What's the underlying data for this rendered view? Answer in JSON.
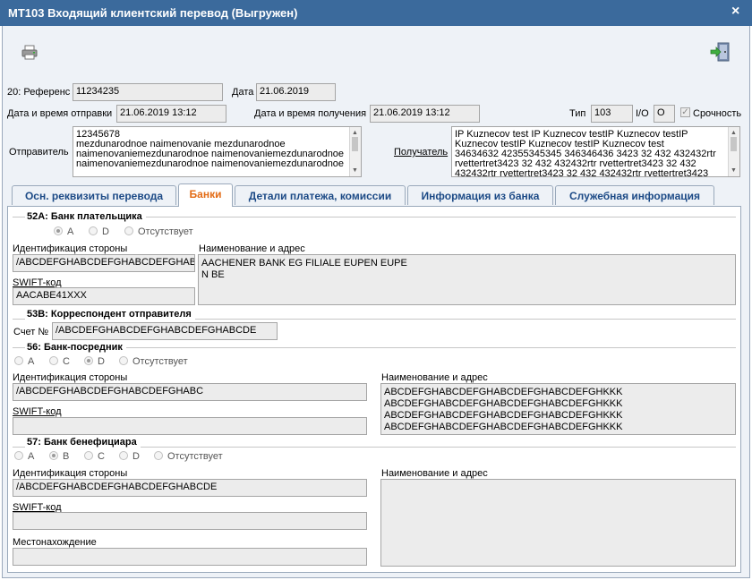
{
  "window": {
    "title": "MT103 Входящий клиентский перевод (Выгружен)",
    "close_glyph": "×"
  },
  "toolbar": {
    "print_icon": "printer-icon",
    "exit_icon": "exit-door-icon"
  },
  "header": {
    "reference_label": "20: Референс",
    "reference_value": "11234235",
    "date_label": "Дата",
    "date_value": "21.06.2019",
    "sent_label": "Дата и время отправки",
    "sent_value": "21.06.2019 13:12",
    "received_label": "Дата и время получения",
    "received_value": "21.06.2019 13:12",
    "type_label": "Тип",
    "type_value": "103",
    "io_label": "I/O",
    "io_value": "O",
    "urgency_label": "Срочность",
    "urgency_checked": true,
    "sender_label": "Отправитель",
    "sender_text": "12345678\nmezdunarodnoe naimenovanie mezdunarodnoe\nnaimenovaniemezdunarodnoe naimenovaniemezdunarodnoe\nnaimenovaniemezdunarodnoe naimenovaniemezdunarodnoe",
    "receiver_label": "Получатель",
    "receiver_text": "IP Kuznecov test IP Kuznecov testIP Kuznecov testIP\nKuznecov testIP Kuznecov testIP Kuznecov test\n34634632 42355345345 346346436 3423 32 432 432432rtr\nrvettertret3423 32 432 432432rtr rvettertret3423 32 432\n432432rtr rvettertret3423 32 432 432432rtr rvettertret3423"
  },
  "tabs": [
    {
      "label": "Осн. реквизиты перевода",
      "active": false
    },
    {
      "label": "Банки",
      "active": true
    },
    {
      "label": "Детали платежа, комиссии",
      "active": false
    },
    {
      "label": "Информация из банка",
      "active": false
    },
    {
      "label": "Служебная информация",
      "active": false
    }
  ],
  "s52a": {
    "title": "52А: Банк плательщика",
    "options": [
      "A",
      "D",
      "Отсутствует"
    ],
    "selected": "A",
    "party_label": "Идентификация стороны",
    "party_value": "/ABCDEFGHABCDEFGHABCDEFGHABCD",
    "swift_label": "SWIFT-код",
    "swift_value": "AACABE41XXX",
    "name_label": "Наименование и адрес",
    "name_value": "AACHENER BANK EG FILIALE EUPEN EUPE\nN BE"
  },
  "s53b": {
    "title": "53В: Корреспондент отправителя",
    "account_label": "Счет №",
    "account_value": "/ABCDEFGHABCDEFGHABCDEFGHABCDE"
  },
  "s56": {
    "title": "56: Банк-посредник",
    "options": [
      "A",
      "C",
      "D",
      "Отсутствует"
    ],
    "selected": "D",
    "party_label": "Идентификация стороны",
    "party_value": "/ABCDEFGHABCDEFGHABCDEFGHABC",
    "swift_label": "SWIFT-код",
    "swift_value": "",
    "name_label": "Наименование и адрес",
    "name_value": "ABCDEFGHABCDEFGHABCDEFGHABCDEFGHKKK\nABCDEFGHABCDEFGHABCDEFGHABCDEFGHKKK\nABCDEFGHABCDEFGHABCDEFGHABCDEFGHKKK\nABCDEFGHABCDEFGHABCDEFGHABCDEFGHKKK"
  },
  "s57": {
    "title": "57: Банк бенефициара",
    "options": [
      "A",
      "B",
      "C",
      "D",
      "Отсутствует"
    ],
    "selected": "B",
    "party_label": "Идентификация стороны",
    "party_value": "/ABCDEFGHABCDEFGHABCDEFGHABCDE",
    "swift_label": "SWIFT-код",
    "swift_value": "",
    "location_label": "Местонахождение",
    "location_value": "",
    "name_label": "Наименование и адрес",
    "name_value": ""
  },
  "colors": {
    "title_bar": "#3b6a9c",
    "tab_text": "#1c4a86",
    "active_tab_text": "#e36c16"
  }
}
